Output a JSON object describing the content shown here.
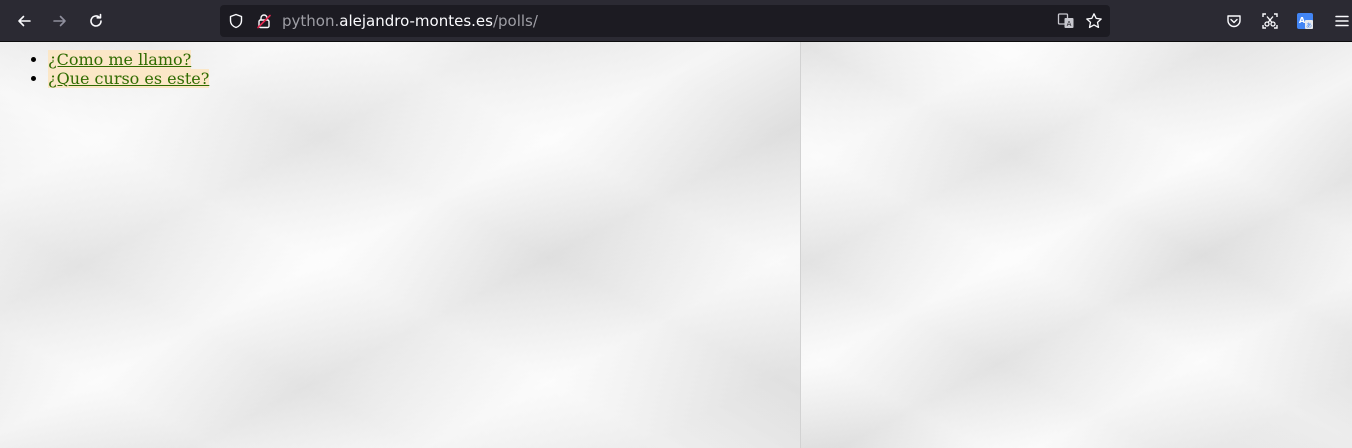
{
  "browser": {
    "url_prefix": "python.",
    "url_domain": "alejandro-montes.es",
    "url_path": "/polls/",
    "icons": {
      "back": "back-arrow-icon",
      "forward": "forward-arrow-icon",
      "reload": "reload-icon",
      "tracking": "shield-icon",
      "security": "lock-icon",
      "translate": "translate-icon",
      "bookmark": "star-icon",
      "pocket": "pocket-icon",
      "screenshot": "screenshot-icon",
      "extension": "translate-extension-icon",
      "menu": "hamburger-menu-icon"
    },
    "colors": {
      "toolbar": "#2b2a33",
      "urlbar": "#1c1b22",
      "link": "#2f6b00",
      "link_highlight": "#fbe7c7"
    }
  },
  "page": {
    "polls": [
      {
        "label": "¿Como me llamo?"
      },
      {
        "label": "¿Que curso es este?"
      }
    ]
  }
}
